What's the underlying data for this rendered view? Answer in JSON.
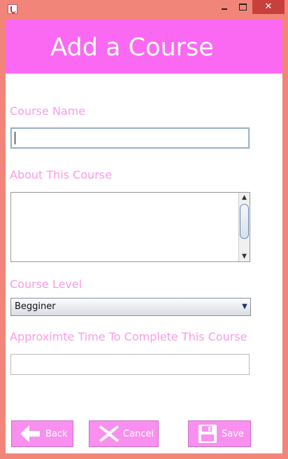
{
  "window": {
    "title": "",
    "close_glyph": "✕"
  },
  "header": {
    "title": "Add a Course"
  },
  "form": {
    "course_name_label": "Course Name",
    "course_name_value": "",
    "about_label": "About This Course",
    "about_value": "",
    "level_label": "Course  Level",
    "level_selected": "Begginer",
    "time_label": "Approximte Time To Complete This Course",
    "time_value": ""
  },
  "buttons": {
    "back": "Back",
    "cancel": "Cancel",
    "save": "Save"
  },
  "colors": {
    "header": "#fb69f3",
    "label": "#f99ce8",
    "button": "#f990ef",
    "frame": "#f1857a"
  },
  "icons": {
    "back": "arrow-left-icon",
    "cancel": "x-icon",
    "save": "floppy-disk-icon"
  }
}
